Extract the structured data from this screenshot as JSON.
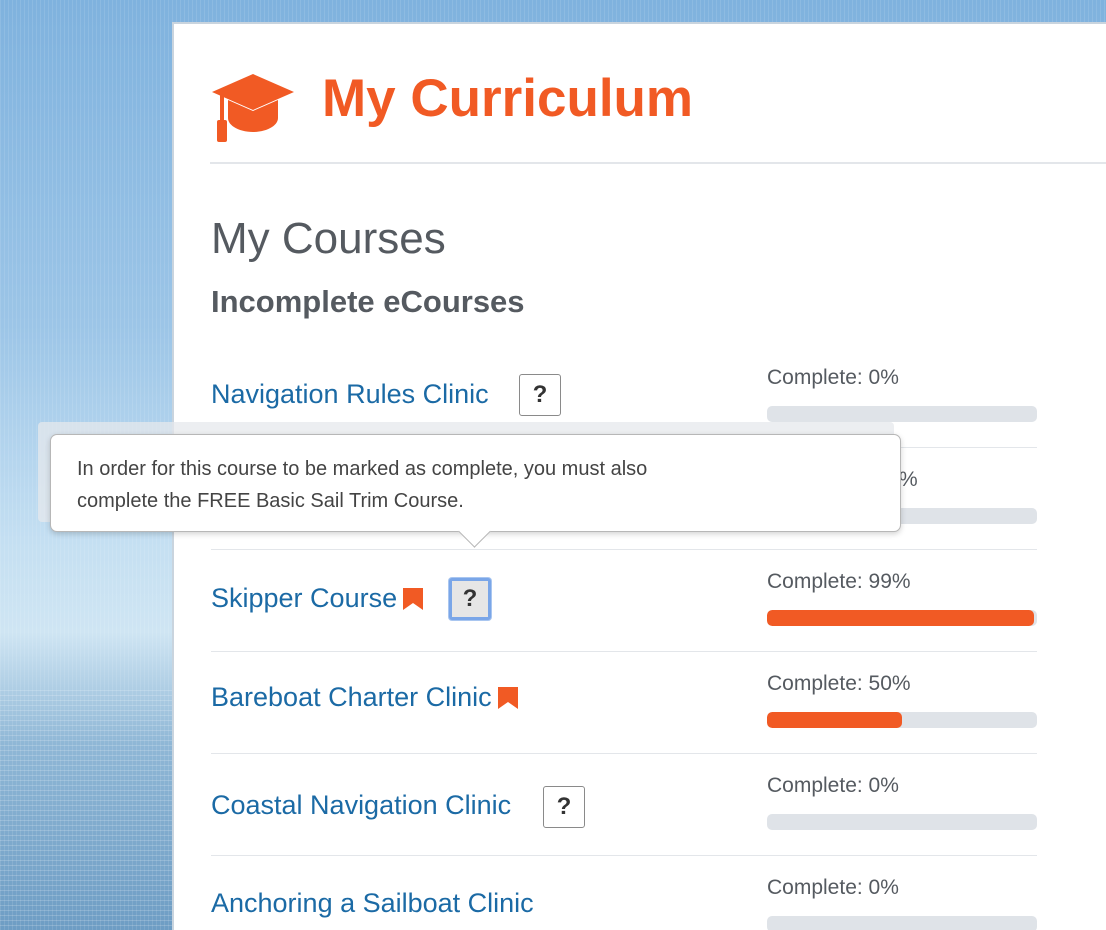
{
  "header": {
    "title": "My Curriculum",
    "icon": "graduation-cap-icon",
    "accent_color": "#f15a24"
  },
  "section_title": "My Courses",
  "subsection_title": "Incomplete eCourses",
  "help_button_label": "?",
  "courses": [
    {
      "name": "Navigation Rules Clinic",
      "progress_text": "Complete: 0%",
      "progress": 0,
      "has_bookmark": false,
      "has_help": true
    },
    {
      "name": "",
      "progress_text": "%",
      "progress": 0,
      "has_bookmark": false,
      "has_help": false
    },
    {
      "name": "Skipper Course",
      "progress_text": "Complete: 99%",
      "progress": 99,
      "has_bookmark": true,
      "has_help": true
    },
    {
      "name": "Bareboat Charter Clinic",
      "progress_text": "Complete: 50%",
      "progress": 50,
      "has_bookmark": true,
      "has_help": false
    },
    {
      "name": "Coastal Navigation Clinic",
      "progress_text": "Complete: 0%",
      "progress": 0,
      "has_bookmark": false,
      "has_help": true
    },
    {
      "name": "Anchoring a Sailboat Clinic",
      "progress_text": "Complete: 0%",
      "progress": 0,
      "has_bookmark": false,
      "has_help": false
    }
  ],
  "tooltip": {
    "line1": "In order for this course to be marked as complete, you must also",
    "line2": "complete the FREE Basic Sail Trim Course."
  },
  "colors": {
    "link": "#1b6aa5",
    "progress_fill": "#f15a24",
    "progress_track": "#dfe3e8"
  }
}
